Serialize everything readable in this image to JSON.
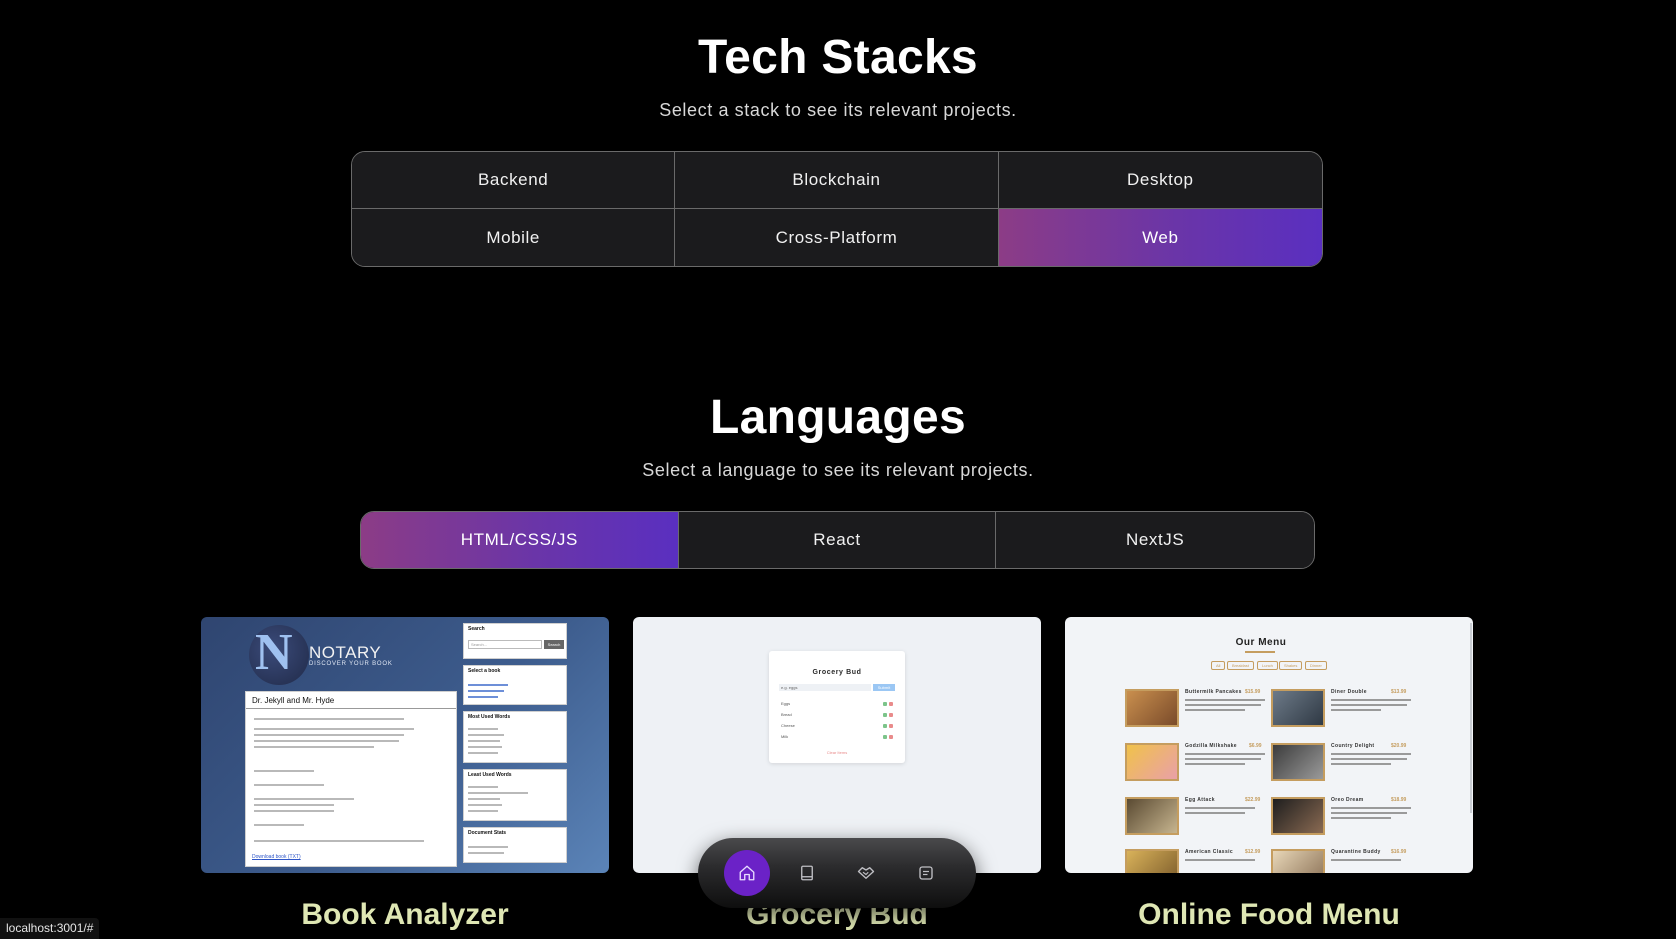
{
  "tech_stacks": {
    "title": "Tech Stacks",
    "subtitle": "Select a stack to see its relevant projects.",
    "options": [
      "Backend",
      "Blockchain",
      "Desktop",
      "Mobile",
      "Cross-Platform",
      "Web"
    ],
    "selected": "Web"
  },
  "languages": {
    "title": "Languages",
    "subtitle": "Select a language to see its relevant projects.",
    "options": [
      "HTML/CSS/JS",
      "React",
      "NextJS"
    ],
    "selected": "HTML/CSS/JS"
  },
  "projects": [
    {
      "title": "Book Analyzer",
      "preview": {
        "brand": "NOTARY",
        "tagline": "DISCOVER YOUR BOOK",
        "doc_title": "Dr. Jekyll and Mr. Hyde",
        "search_label": "Search",
        "search_placeholder": "Search...",
        "search_button": "Search",
        "panels": [
          "Select a book",
          "Most Used Words",
          "Least Used Words",
          "Document Stats"
        ],
        "download_link": "Download book (TXT)"
      }
    },
    {
      "title": "Grocery Bud",
      "preview": {
        "heading": "Grocery Bud",
        "input_value": "e.g. eggs",
        "button": "Submit",
        "items": [
          "Eggs",
          "Bread",
          "Cheese",
          "Milk"
        ],
        "clear": "Clear Items"
      }
    },
    {
      "title": "Online Food Menu",
      "preview": {
        "heading": "Our Menu",
        "filters": [
          "All",
          "Breakfast",
          "Lunch",
          "Shakes",
          "Dinner"
        ],
        "items": [
          {
            "name": "Buttermilk Pancakes",
            "price": "$15.99"
          },
          {
            "name": "Diner Double",
            "price": "$13.99"
          },
          {
            "name": "Godzilla Milkshake",
            "price": "$6.99"
          },
          {
            "name": "Country Delight",
            "price": "$20.99"
          },
          {
            "name": "Egg Attack",
            "price": "$22.99"
          },
          {
            "name": "Oreo Dream",
            "price": "$18.99"
          },
          {
            "name": "American Classic",
            "price": "$12.99"
          },
          {
            "name": "Quarantine Buddy",
            "price": "$16.99"
          }
        ]
      }
    }
  ],
  "dock": {
    "items": [
      "home-icon",
      "book-icon",
      "handshake-icon",
      "message-icon"
    ],
    "active": "home-icon",
    "active_color": "#6b22c7"
  },
  "status_bar": {
    "url": "localhost:3001/#"
  },
  "colors": {
    "accent_gradient_start": "#8c3c86",
    "accent_gradient_end": "#5a2fc0",
    "project_title": "#dfe7b4"
  }
}
